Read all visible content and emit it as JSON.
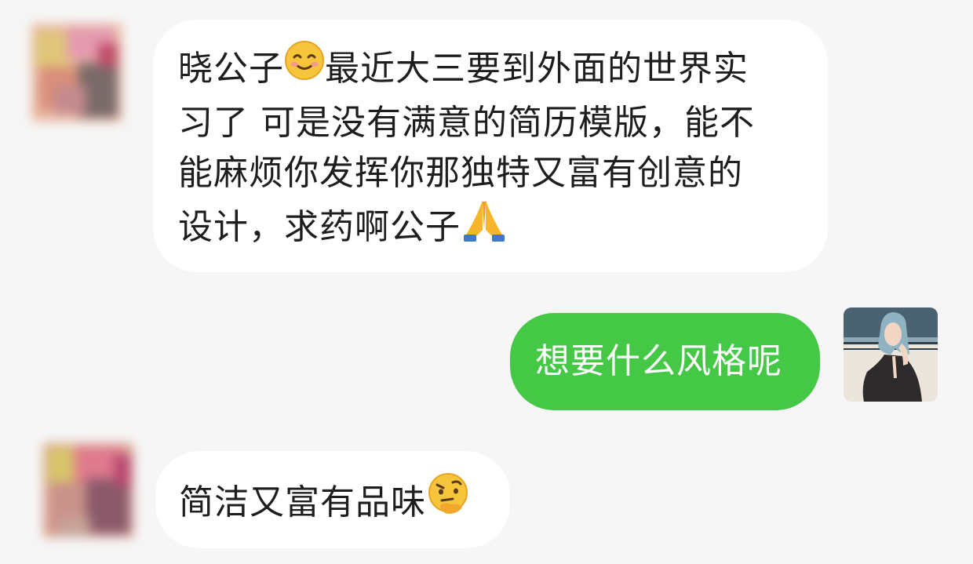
{
  "messages": [
    {
      "sender": "contact",
      "lines": [
        "晓公子",
        "最近大三要到外面的世界实",
        "习了 可是没有满意的简历模版，能不",
        "能麻烦你发挥你那独特又富有创意的",
        "设计，求药啊公子"
      ],
      "emojis": [
        "smiling-face-emoji",
        "folded-hands-emoji"
      ]
    },
    {
      "sender": "me",
      "text": "想要什么风格呢"
    },
    {
      "sender": "contact",
      "text": "简洁又富有品味",
      "emojis": [
        "face-with-raised-eyebrow-hand-on-chin-emoji"
      ]
    }
  ],
  "colors": {
    "background": "#f6f6f6",
    "incoming_bubble": "#ffffff",
    "outgoing_bubble": "#46c847",
    "text_dark": "#1e1e1e",
    "text_light": "#ffffff"
  }
}
